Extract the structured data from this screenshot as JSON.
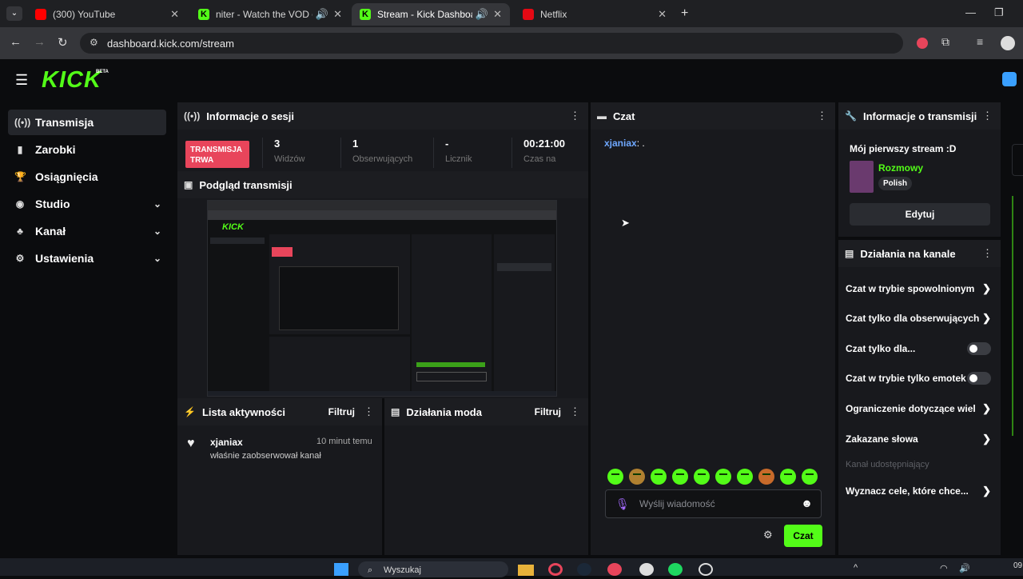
{
  "browser": {
    "tabs": [
      {
        "title": "(300) YouTube",
        "color": "#ff0000"
      },
      {
        "title": "niter - Watch the VOD on K",
        "color": "#53fc18"
      },
      {
        "title": "Stream - Kick Dashboard",
        "color": "#53fc18"
      },
      {
        "title": "Netflix",
        "color": "#e50914"
      }
    ],
    "url": "dashboard.kick.com/stream"
  },
  "app": {
    "logo": "KICK",
    "logo_badge": "BETA",
    "accent": "#53fc18"
  },
  "sidebar": {
    "items": [
      {
        "label": "Transmisja",
        "icon": "broadcast-icon"
      },
      {
        "label": "Zarobki",
        "icon": "chart-icon"
      },
      {
        "label": "Osiągnięcia",
        "icon": "trophy-icon"
      },
      {
        "label": "Studio",
        "icon": "camera-icon"
      },
      {
        "label": "Kanał",
        "icon": "users-icon"
      },
      {
        "label": "Ustawienia",
        "icon": "gear-icon"
      }
    ]
  },
  "session": {
    "title": "Informacje o sesji",
    "live_badge_line1": "TRANSMISJA",
    "live_badge_line2": "TRWA",
    "viewers": "3",
    "viewers_label": "Widzów",
    "followers": "1",
    "followers_label": "Obserwujących",
    "counter": "-",
    "counter_label": "Licznik",
    "time": "00:21:00",
    "time_label": "Czas na"
  },
  "preview": {
    "title": "Podgląd transmisji"
  },
  "activity": {
    "title": "Lista aktywności",
    "filter": "Filtruj",
    "items": [
      {
        "user": "xjaniax",
        "time": "10 minut temu",
        "text": "właśnie zaobserwował kanał"
      }
    ]
  },
  "mod": {
    "title": "Działania moda",
    "filter": "Filtruj"
  },
  "chat": {
    "title": "Czat",
    "messages": [
      {
        "user": "xjaniax",
        "text": ": ."
      }
    ],
    "placeholder": "Wyślij wiadomość",
    "send": "Czat"
  },
  "stream_info": {
    "title": "Informacje o transmisji",
    "stream_title": "Mój pierwszy stream :D",
    "category": "Rozmowy",
    "language": "Polish",
    "edit": "Edytuj"
  },
  "channel_actions": {
    "title": "Działania na kanale",
    "items": [
      {
        "label": "Czat w trybie spowolnionym",
        "kind": "arrow"
      },
      {
        "label": "Czat tylko dla obserwujących",
        "kind": "arrow"
      },
      {
        "label": "Czat tylko dla...",
        "kind": "toggle"
      },
      {
        "label": "Czat w trybie tylko emotek",
        "kind": "toggle"
      },
      {
        "label": "Ograniczenie dotyczące wiel",
        "kind": "arrow"
      },
      {
        "label": "Zakazane słowa",
        "kind": "arrow"
      }
    ],
    "section_label": "Kanał udostępniający",
    "goals": "Wyznacz cele, które chce..."
  },
  "taskbar": {
    "search": "Wyszukaj",
    "clock": "09"
  }
}
